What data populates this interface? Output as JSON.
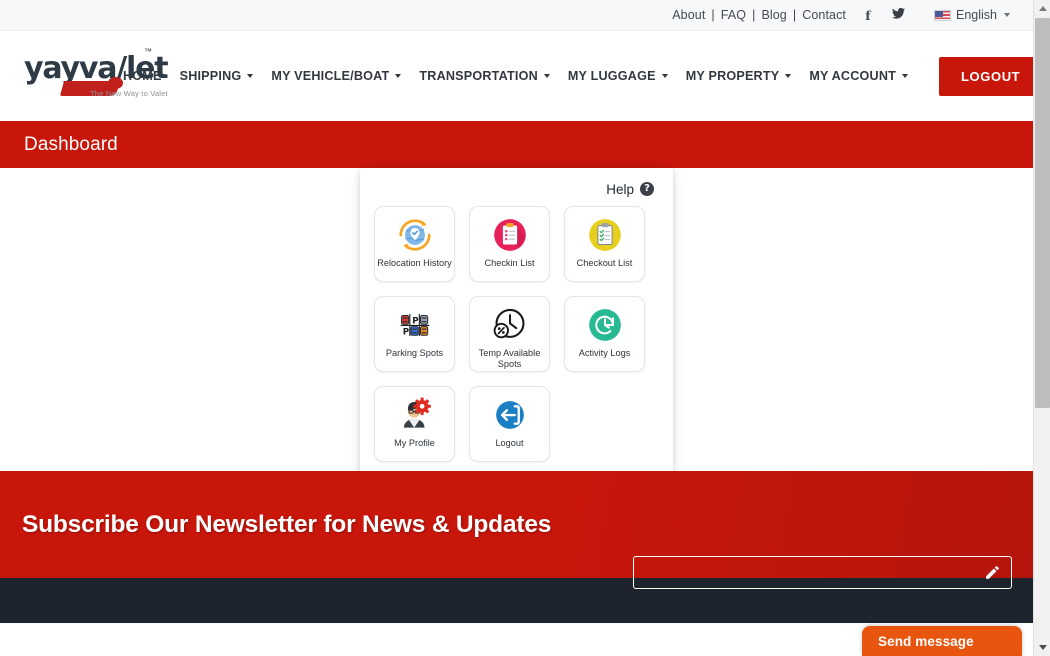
{
  "topbar": {
    "links": [
      "About",
      "FAQ",
      "Blog",
      "Contact"
    ],
    "separator": "|",
    "social": [
      {
        "name": "facebook-icon",
        "glyph": "f"
      },
      {
        "name": "twitter-icon",
        "glyph": "🐦"
      }
    ],
    "language": "English"
  },
  "brand": {
    "word": "yayva",
    "word_tail": "let",
    "word_slash": "/",
    "tm": "™",
    "tagline": "The New Way to Valet"
  },
  "nav": {
    "items": [
      {
        "label": "HOME",
        "dropdown": false
      },
      {
        "label": "SHIPPING",
        "dropdown": true
      },
      {
        "label": "MY VEHICLE/BOAT",
        "dropdown": true
      },
      {
        "label": "TRANSPORTATION",
        "dropdown": true
      },
      {
        "label": "MY LUGGAGE",
        "dropdown": true
      },
      {
        "label": "MY PROPERTY",
        "dropdown": true
      },
      {
        "label": "MY ACCOUNT",
        "dropdown": true
      }
    ],
    "logout_label": "LOGOUT"
  },
  "page": {
    "title": "Dashboard"
  },
  "panel": {
    "help_label": "Help",
    "help_icon_glyph": "?",
    "tiles": [
      {
        "label": "Relocation History",
        "icon": "globe-location-refresh-icon"
      },
      {
        "label": "Checkin List",
        "icon": "clipboard-checkin-icon"
      },
      {
        "label": "Checkout List",
        "icon": "clipboard-checkout-icon"
      },
      {
        "label": "Parking Spots",
        "icon": "parking-grid-icon"
      },
      {
        "label": "Temp Available Spots",
        "icon": "clock-percent-icon"
      },
      {
        "label": "Activity Logs",
        "icon": "clock-history-icon"
      },
      {
        "label": "My Profile",
        "icon": "user-gear-icon"
      },
      {
        "label": "Logout",
        "icon": "exit-arrow-icon"
      }
    ]
  },
  "newsletter": {
    "heading": "Subscribe Our Newsletter for News & Updates",
    "input_value": "",
    "input_placeholder": "",
    "edit_icon": "pencil-icon"
  },
  "chat": {
    "label": "Send message"
  },
  "colors": {
    "brand_red": "#c8160b",
    "dark_footer": "#1e242e",
    "chat_orange": "#e8550f",
    "topbar_bg": "#f7f8fa"
  }
}
